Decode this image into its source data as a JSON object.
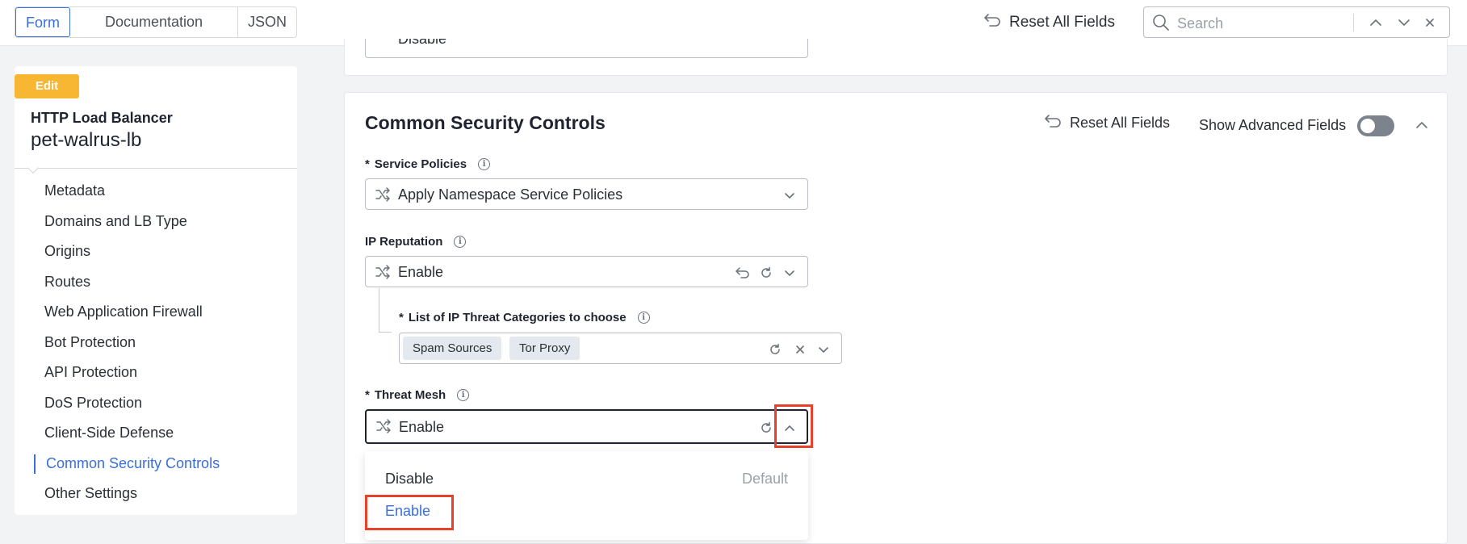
{
  "topbar": {
    "tabs": [
      {
        "label": "Form",
        "active": true
      },
      {
        "label": "Documentation",
        "active": false
      },
      {
        "label": "JSON",
        "active": false
      }
    ],
    "reset_label": "Reset All Fields",
    "search_placeholder": "Search"
  },
  "sidebar": {
    "badge": "Edit",
    "object_type": "HTTP Load Balancer",
    "object_name": "pet-walrus-lb",
    "items": [
      {
        "label": "Metadata"
      },
      {
        "label": "Domains and LB Type"
      },
      {
        "label": "Origins"
      },
      {
        "label": "Routes"
      },
      {
        "label": "Web Application Firewall"
      },
      {
        "label": "Bot Protection"
      },
      {
        "label": "API Protection"
      },
      {
        "label": "DoS Protection"
      },
      {
        "label": "Client-Side Defense"
      },
      {
        "label": "Common Security Controls",
        "active": true
      },
      {
        "label": "Other Settings"
      }
    ]
  },
  "previous_section": {
    "field_value": "Disable"
  },
  "section": {
    "title": "Common Security Controls",
    "reset_label": "Reset All Fields",
    "advanced_label": "Show Advanced Fields",
    "advanced_enabled": false,
    "fields": {
      "service_policies": {
        "required": "*",
        "label": "Service Policies",
        "value": "Apply Namespace Service Policies"
      },
      "ip_reputation": {
        "label": "IP Reputation",
        "value": "Enable"
      },
      "ip_threat_categories": {
        "required": "*",
        "label": "List of IP Threat Categories to choose",
        "chips": [
          "Spam Sources",
          "Tor Proxy"
        ]
      },
      "threat_mesh": {
        "required": "*",
        "label": "Threat Mesh",
        "value": "Enable",
        "options": [
          {
            "label": "Disable",
            "tag": "Default"
          },
          {
            "label": "Enable",
            "selected": true
          }
        ]
      }
    }
  },
  "colors": {
    "accent": "#3b6fd8",
    "badge": "#f7b733",
    "highlight": "#e8402a"
  }
}
